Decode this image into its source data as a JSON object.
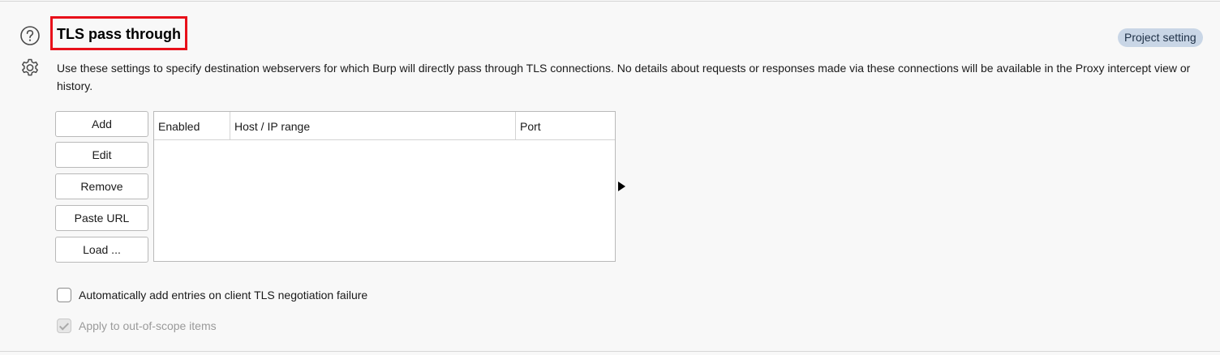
{
  "section": {
    "title": "TLS pass through",
    "badge": "Project setting",
    "description": "Use these settings to specify destination webservers for which Burp will directly pass through TLS connections. No details about requests or responses made via these connections will be available in the Proxy intercept view or history."
  },
  "buttons": {
    "add": "Add",
    "edit": "Edit",
    "remove": "Remove",
    "paste_url": "Paste URL",
    "load": "Load ..."
  },
  "table": {
    "columns": [
      "Enabled",
      "Host / IP range",
      "Port"
    ],
    "rows": []
  },
  "options": {
    "auto_add_label": "Automatically add entries on client TLS negotiation failure",
    "auto_add_checked": false,
    "out_of_scope_label": "Apply to out-of-scope items",
    "out_of_scope_checked": true,
    "out_of_scope_enabled": false
  },
  "colors": {
    "highlight_border": "#e8101a",
    "badge_background": "#c9d6e6"
  },
  "icons": {
    "help": "question-circle-icon",
    "settings": "gear-icon",
    "expand": "triangle-right-icon"
  }
}
